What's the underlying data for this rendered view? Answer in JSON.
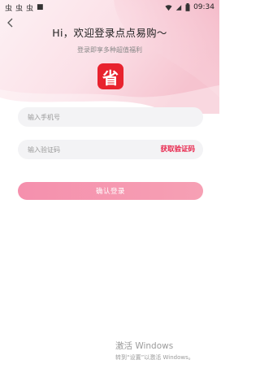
{
  "status_bar": {
    "notifications": [
      "虫",
      "虫",
      "虫",
      "■"
    ],
    "time": "09:34"
  },
  "header": {
    "greeting": "Hi，欢迎登录点点易购〜",
    "subtitle": "登录即享多种超值福利",
    "logo_char": "省"
  },
  "form": {
    "phone_placeholder": "输入手机号",
    "code_placeholder": "输入验证码",
    "get_code_label": "获取验证码",
    "login_label": "确认登录"
  },
  "watermark": {
    "title": "激活 Windows",
    "subtitle": "转到“设置”以激活 Windows。"
  },
  "colors": {
    "accent": "#e8234a",
    "logo_bg": "#e8222e",
    "button_start": "#f590ad",
    "button_end": "#f6a0b4",
    "hero_pink": "#f7c6d3",
    "field_bg": "#f3f3f5"
  }
}
